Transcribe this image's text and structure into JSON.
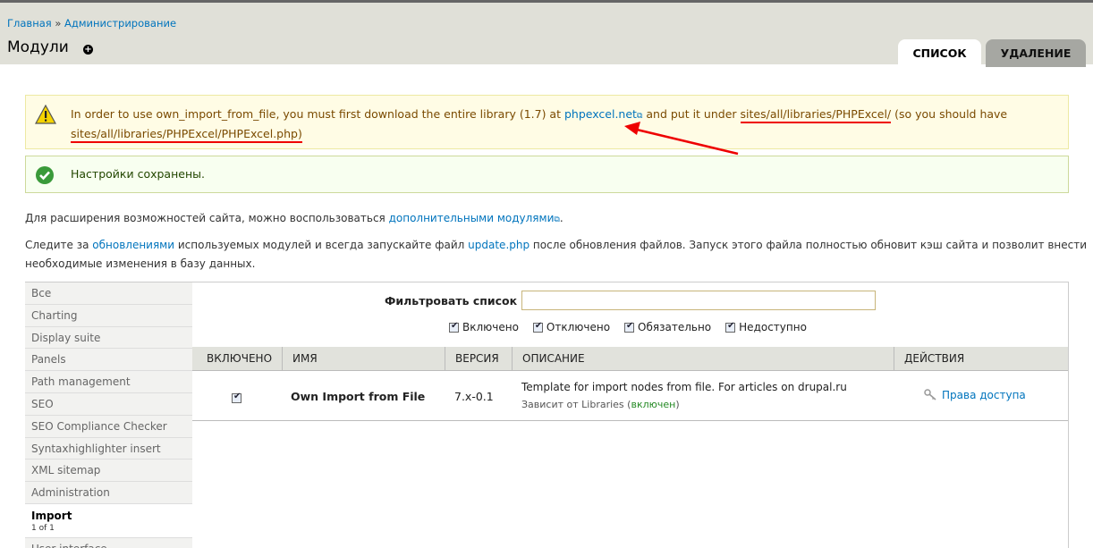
{
  "breadcrumb": {
    "home": "Главная",
    "separator": "»",
    "admin": "Администрирование"
  },
  "page_title": "Модули",
  "tabs": {
    "list": "СПИСОК",
    "uninstall": "УДАЛЕНИЕ"
  },
  "warning": {
    "part1": "In order to use own_import_from_file, you must first download the entire library (1.7) at ",
    "link": "phpexcel.net",
    "part2": " and put it under ",
    "path1": "sites/all/libraries/PHPExcel/",
    "part3": " (so you should have ",
    "path2": "sites/all/libraries/PHPExcel/PHPExcel.php)"
  },
  "status": "Настройки сохранены.",
  "para1": {
    "text": "Для расширения возможностей сайта, можно воспользоваться ",
    "link": "дополнительными модулями",
    "end": "."
  },
  "para2": {
    "part1": "Следите за ",
    "link1": "обновлениями",
    "part2": " используемых модулей и всегда запускайте файл ",
    "link2": "update.php",
    "part3": " после обновления файлов. Запуск этого файла полностью обновит кэш сайта и позволит внести",
    "line2": "необходимые изменения в базу данных."
  },
  "vtabs": [
    "Все",
    "Charting",
    "Display suite",
    "Panels",
    "Path management",
    "SEO",
    "SEO Compliance Checker",
    "Syntaxhighlighter insert",
    "XML sitemap",
    "Administration"
  ],
  "vtab_selected": {
    "label": "Import",
    "sub": "1 of 1"
  },
  "vtab_next": "User interface",
  "filter": {
    "label": "Фильтровать список",
    "value": ""
  },
  "filter_checks": [
    "Включено",
    "Отключено",
    "Обязательно",
    "Недоступно"
  ],
  "table": {
    "headers": [
      "ВКЛЮЧЕНО",
      "ИМЯ",
      "ВЕРСИЯ",
      "ОПИСАНИЕ",
      "ДЕЙСТВИЯ"
    ],
    "row": {
      "name": "Own Import from File",
      "version": "7.x-0.1",
      "description": "Template for import nodes from file. For articles on drupal.ru",
      "requires": "Зависит от Libraries (",
      "requires_status": "включен",
      "requires_end": ")",
      "action": "Права доступа"
    }
  },
  "colors": {
    "link": "#0074bd",
    "warning_bg": "#fffce5",
    "status_bg": "#f8fff0",
    "annotation": "#e00000"
  }
}
